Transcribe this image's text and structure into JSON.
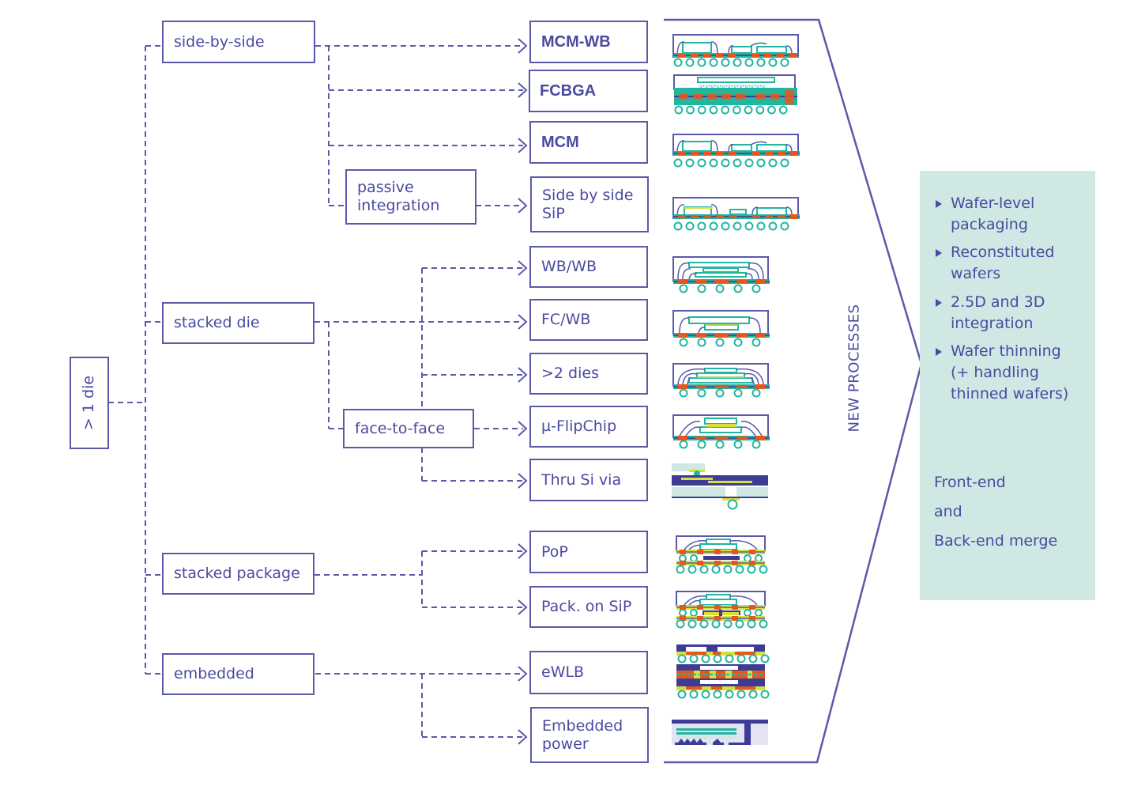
{
  "root": {
    "label": "> 1 die"
  },
  "categories": [
    {
      "id": "side-by-side",
      "label": "side-by-side"
    },
    {
      "id": "stacked-die",
      "label": "stacked die"
    },
    {
      "id": "stacked-package",
      "label": "stacked package"
    },
    {
      "id": "embedded",
      "label": "embedded"
    }
  ],
  "subcategories": [
    {
      "id": "passive-integration",
      "label": "passive\nintegration"
    },
    {
      "id": "face-to-face",
      "label": "face-to-face"
    }
  ],
  "packages": [
    {
      "id": "mcm-wb",
      "label": "MCM-WB",
      "icon": "mcm-wb-cross-section-icon"
    },
    {
      "id": "fcbga",
      "label": "FCBGA",
      "icon": "fcbga-cross-section-icon"
    },
    {
      "id": "mcm",
      "label": "MCM",
      "icon": "mcm-cross-section-icon"
    },
    {
      "id": "side-by-side-sip",
      "label": "Side by side\nSiP",
      "icon": "sip-cross-section-icon"
    },
    {
      "id": "wb-wb",
      "label": "WB/WB",
      "icon": "wb-wb-cross-section-icon"
    },
    {
      "id": "fc-wb",
      "label": "FC/WB",
      "icon": "fc-wb-cross-section-icon"
    },
    {
      "id": "more-than-2-dies",
      "label": ">2 dies",
      "icon": "multi-die-cross-section-icon"
    },
    {
      "id": "micro-flipchip",
      "label": "µ-FlipChip",
      "icon": "micro-flipchip-cross-section-icon"
    },
    {
      "id": "thru-si-via",
      "label": "Thru Si via",
      "icon": "tsv-cross-section-icon"
    },
    {
      "id": "pop",
      "label": "PoP",
      "icon": "pop-cross-section-icon"
    },
    {
      "id": "pack-on-sip",
      "label": "Pack. on SiP",
      "icon": "pack-on-sip-cross-section-icon"
    },
    {
      "id": "ewlb",
      "label": "eWLB",
      "icon": "ewlb-cross-section-icon"
    },
    {
      "id": "embedded-power",
      "label": "Embedded\npower",
      "icon": "embedded-power-cross-section-icon"
    }
  ],
  "arrow_label": "NEW PROCESSES",
  "side_panel": {
    "bullets": [
      "Wafer-level\npackaging",
      "Reconstituted\nwafers",
      "2.5D and 3D\nintegration",
      "Wafer thinning\n(+ handling\nthinned wafers)"
    ],
    "merge_lines": [
      "Front-end",
      "and",
      "Back-end merge"
    ]
  },
  "colors": {
    "line": "#5a5aab",
    "text": "#4a4aa0",
    "teal": "#22b5a0",
    "orange": "#e8561c",
    "yellow": "#d6e03a",
    "navy": "#3c3c96",
    "panel": "#cfe8e4"
  }
}
